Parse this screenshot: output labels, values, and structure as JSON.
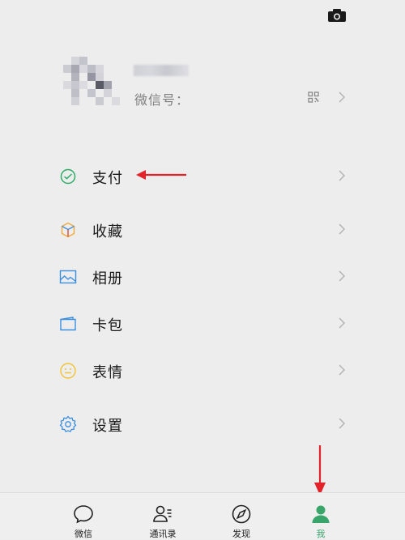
{
  "header": {
    "camera_icon": "camera-icon"
  },
  "profile": {
    "wechat_id_label": "微信号：",
    "qr_icon": "qr-code-icon"
  },
  "menu": [
    {
      "label": "支付",
      "icon": "pay-icon"
    },
    {
      "label": "收藏",
      "icon": "favorites-icon"
    },
    {
      "label": "相册",
      "icon": "album-icon"
    },
    {
      "label": "卡包",
      "icon": "card-pack-icon"
    },
    {
      "label": "表情",
      "icon": "sticker-icon"
    },
    {
      "label": "设置",
      "icon": "settings-icon"
    }
  ],
  "tabs": [
    {
      "label": "微信",
      "icon": "chat-icon",
      "active": false
    },
    {
      "label": "通讯录",
      "icon": "contacts-icon",
      "active": false
    },
    {
      "label": "发现",
      "icon": "discover-icon",
      "active": false
    },
    {
      "label": "我",
      "icon": "me-icon",
      "active": true
    }
  ],
  "colors": {
    "background": "#ededed",
    "accent_green": "#3aa56b",
    "annotation_red": "#e2232a",
    "chevron": "#b3b3b3"
  }
}
